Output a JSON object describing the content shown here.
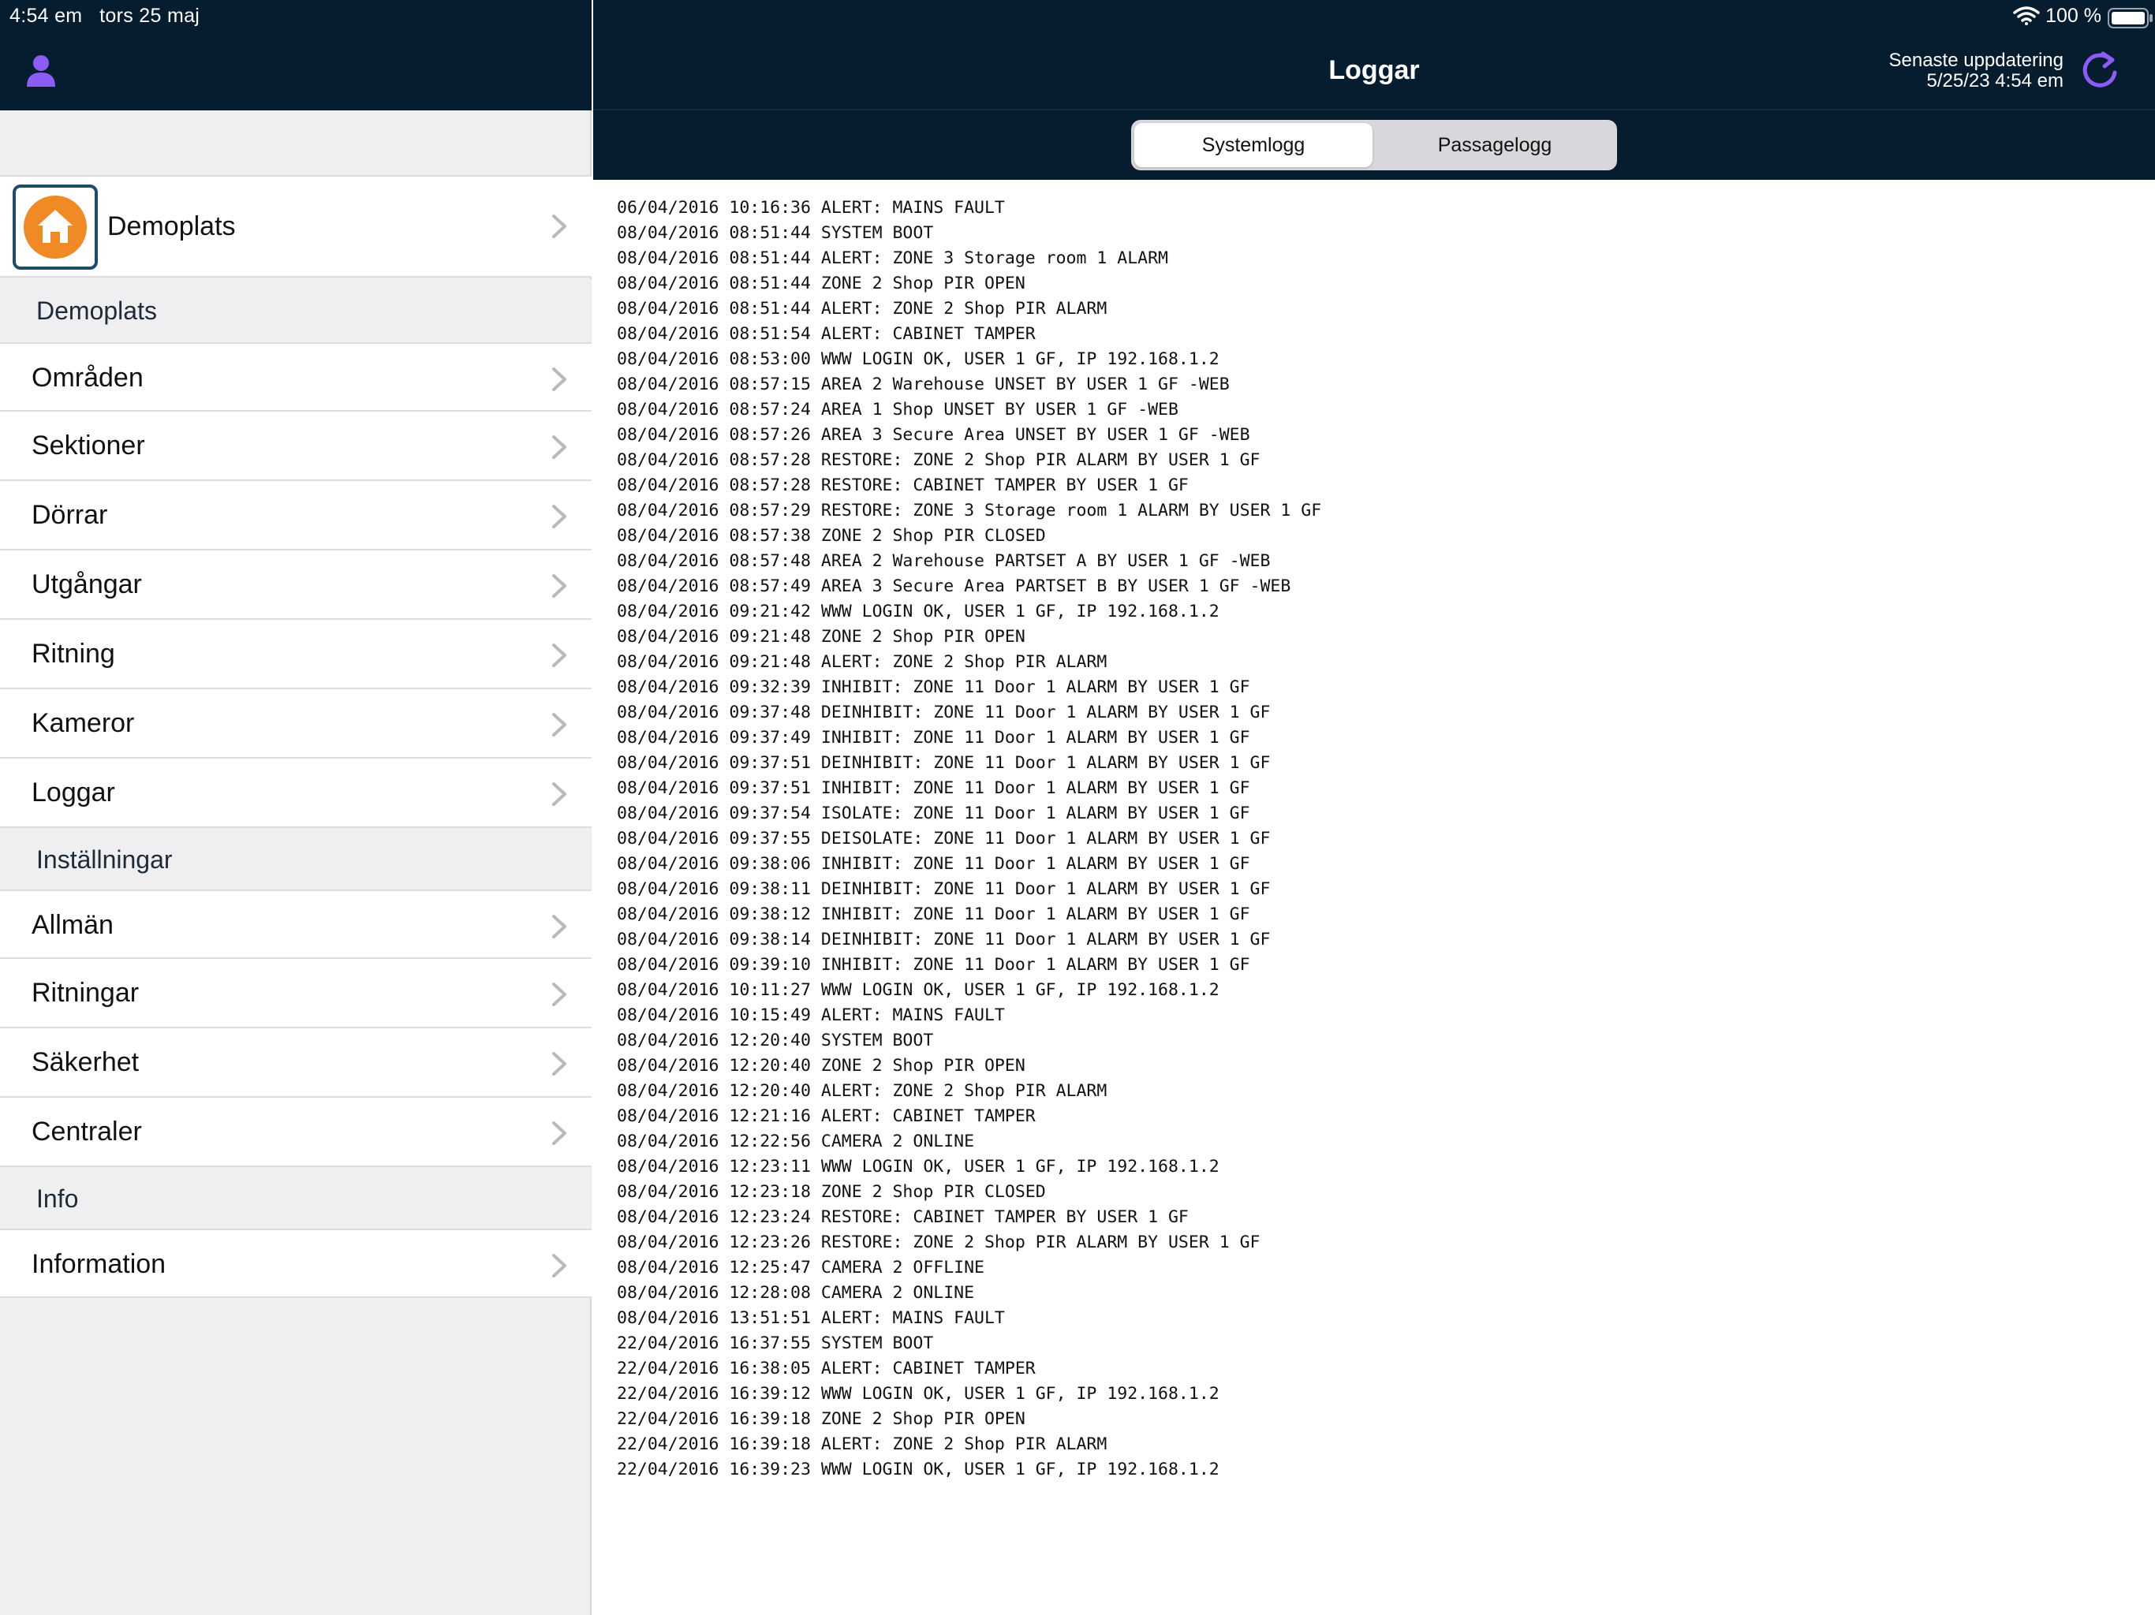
{
  "status_bar": {
    "time_date": "4:54 em   tors 25 maj",
    "battery": "100 %"
  },
  "sidebar": {
    "site": {
      "label": "Demoplats"
    },
    "sections": [
      {
        "title": "Demoplats",
        "items": [
          "Områden",
          "Sektioner",
          "Dörrar",
          "Utgångar",
          "Ritning",
          "Kameror",
          "Loggar"
        ]
      },
      {
        "title": "Inställningar",
        "items": [
          "Allmän",
          "Ritningar",
          "Säkerhet",
          "Centraler"
        ]
      },
      {
        "title": "Info",
        "items": [
          "Information"
        ]
      }
    ]
  },
  "header": {
    "title": "Loggar",
    "update_label": "Senaste uppdatering",
    "update_time": "5/25/23 4:54 em"
  },
  "tabs": {
    "active": "Systemlogg",
    "inactive": "Passagelogg"
  },
  "colors": {
    "header_bg": "#061d30",
    "accent": "#8b5cf6",
    "site_icon": "#f08a24"
  },
  "log_lines": [
    "06/04/2016 10:16:36 ALERT: MAINS FAULT",
    "08/04/2016 08:51:44 SYSTEM BOOT",
    "08/04/2016 08:51:44 ALERT: ZONE 3 Storage room 1 ALARM",
    "08/04/2016 08:51:44 ZONE 2 Shop PIR OPEN",
    "08/04/2016 08:51:44 ALERT: ZONE 2 Shop PIR ALARM",
    "08/04/2016 08:51:54 ALERT: CABINET TAMPER",
    "08/04/2016 08:53:00 WWW LOGIN OK, USER 1 GF, IP 192.168.1.2",
    "08/04/2016 08:57:15 AREA 2 Warehouse UNSET BY USER 1 GF -WEB",
    "08/04/2016 08:57:24 AREA 1 Shop UNSET BY USER 1 GF -WEB",
    "08/04/2016 08:57:26 AREA 3 Secure Area UNSET BY USER 1 GF -WEB",
    "08/04/2016 08:57:28 RESTORE: ZONE 2 Shop PIR ALARM BY USER 1 GF",
    "08/04/2016 08:57:28 RESTORE: CABINET TAMPER BY USER 1 GF",
    "08/04/2016 08:57:29 RESTORE: ZONE 3 Storage room 1 ALARM BY USER 1 GF",
    "08/04/2016 08:57:38 ZONE 2 Shop PIR CLOSED",
    "08/04/2016 08:57:48 AREA 2 Warehouse PARTSET A BY USER 1 GF -WEB",
    "08/04/2016 08:57:49 AREA 3 Secure Area PARTSET B BY USER 1 GF -WEB",
    "08/04/2016 09:21:42 WWW LOGIN OK, USER 1 GF, IP 192.168.1.2",
    "08/04/2016 09:21:48 ZONE 2 Shop PIR OPEN",
    "08/04/2016 09:21:48 ALERT: ZONE 2 Shop PIR ALARM",
    "08/04/2016 09:32:39 INHIBIT: ZONE 11 Door 1 ALARM BY USER 1 GF",
    "08/04/2016 09:37:48 DEINHIBIT: ZONE 11 Door 1 ALARM BY USER 1 GF",
    "08/04/2016 09:37:49 INHIBIT: ZONE 11 Door 1 ALARM BY USER 1 GF",
    "08/04/2016 09:37:51 DEINHIBIT: ZONE 11 Door 1 ALARM BY USER 1 GF",
    "08/04/2016 09:37:51 INHIBIT: ZONE 11 Door 1 ALARM BY USER 1 GF",
    "08/04/2016 09:37:54 ISOLATE: ZONE 11 Door 1 ALARM BY USER 1 GF",
    "08/04/2016 09:37:55 DEISOLATE: ZONE 11 Door 1 ALARM BY USER 1 GF",
    "08/04/2016 09:38:06 INHIBIT: ZONE 11 Door 1 ALARM BY USER 1 GF",
    "08/04/2016 09:38:11 DEINHIBIT: ZONE 11 Door 1 ALARM BY USER 1 GF",
    "08/04/2016 09:38:12 INHIBIT: ZONE 11 Door 1 ALARM BY USER 1 GF",
    "08/04/2016 09:38:14 DEINHIBIT: ZONE 11 Door 1 ALARM BY USER 1 GF",
    "08/04/2016 09:39:10 INHIBIT: ZONE 11 Door 1 ALARM BY USER 1 GF",
    "08/04/2016 10:11:27 WWW LOGIN OK, USER 1 GF, IP 192.168.1.2",
    "08/04/2016 10:15:49 ALERT: MAINS FAULT",
    "08/04/2016 12:20:40 SYSTEM BOOT",
    "08/04/2016 12:20:40 ZONE 2 Shop PIR OPEN",
    "08/04/2016 12:20:40 ALERT: ZONE 2 Shop PIR ALARM",
    "08/04/2016 12:21:16 ALERT: CABINET TAMPER",
    "08/04/2016 12:22:56 CAMERA 2 ONLINE",
    "08/04/2016 12:23:11 WWW LOGIN OK, USER 1 GF, IP 192.168.1.2",
    "08/04/2016 12:23:18 ZONE 2 Shop PIR CLOSED",
    "08/04/2016 12:23:24 RESTORE: CABINET TAMPER BY USER 1 GF",
    "08/04/2016 12:23:26 RESTORE: ZONE 2 Shop PIR ALARM BY USER 1 GF",
    "08/04/2016 12:25:47 CAMERA 2 OFFLINE",
    "08/04/2016 12:28:08 CAMERA 2 ONLINE",
    "08/04/2016 13:51:51 ALERT: MAINS FAULT",
    "22/04/2016 16:37:55 SYSTEM BOOT",
    "22/04/2016 16:38:05 ALERT: CABINET TAMPER",
    "22/04/2016 16:39:12 WWW LOGIN OK, USER 1 GF, IP 192.168.1.2",
    "22/04/2016 16:39:18 ZONE 2 Shop PIR OPEN",
    "22/04/2016 16:39:18 ALERT: ZONE 2 Shop PIR ALARM",
    "22/04/2016 16:39:23 WWW LOGIN OK, USER 1 GF, IP 192.168.1.2"
  ]
}
